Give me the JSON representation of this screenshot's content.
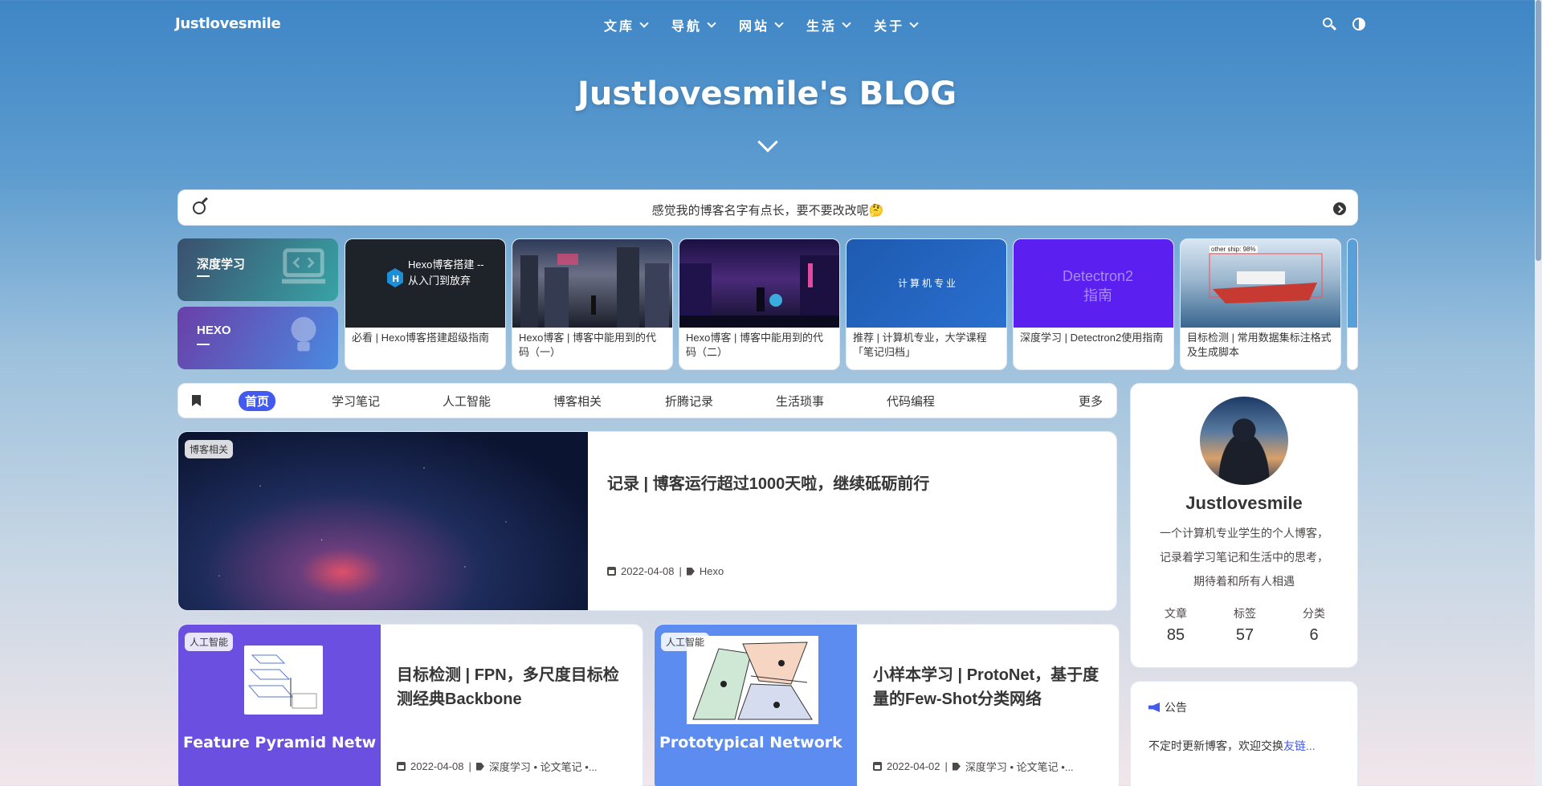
{
  "nav": {
    "brand": "Justlovesmile",
    "menu": [
      "文库",
      "导航",
      "网站",
      "生活",
      "关于"
    ],
    "icons": [
      "search-icon",
      "darkmode-icon"
    ]
  },
  "hero": {
    "title": "Justlovesmile's BLOG"
  },
  "announcement": {
    "text": "感觉我的博客名字有点长，要不要改改呢🤔"
  },
  "categories": [
    {
      "label": "深度学习"
    },
    {
      "label": "HEXO"
    }
  ],
  "swiper": [
    {
      "title": "必看 | Hexo博客搭建超级指南",
      "img_text": "Hexo博客搭建 -- 从入门到放弃"
    },
    {
      "title": "Hexo博客 | 博客中能用到的代码（一）"
    },
    {
      "title": "Hexo博客 | 博客中能用到的代码（二）"
    },
    {
      "title": "推荐 | 计算机专业，大学课程「笔记归档」",
      "img_text": "计算机专业"
    },
    {
      "title": "深度学习 | Detectron2使用指南",
      "img_text": "Detectron2 指南"
    },
    {
      "title": "目标检测 | 常用数据集标注格式及生成脚本",
      "img_text": "other ship: 98%"
    }
  ],
  "tabs": {
    "items": [
      "首页",
      "学习笔记",
      "人工智能",
      "博客相关",
      "折腾记录",
      "生活琐事",
      "代码编程"
    ],
    "more": "更多"
  },
  "posts": [
    {
      "tag": "博客相关",
      "title": "记录 | 博客运行超过1000天啦，继续砥砺前行",
      "date": "2022-04-08",
      "tags": "Hexo"
    },
    {
      "tag": "人工智能",
      "title": "目标检测 | FPN，多尺度目标检测经典Backbone",
      "date": "2022-04-08",
      "tags": "深度学习 • 论文笔记 •...",
      "img_caption": "Feature Pyramid Netw"
    },
    {
      "tag": "人工智能",
      "title": "小样本学习 | ProtoNet，基于度量的Few-Shot分类网络",
      "date": "2022-04-02",
      "tags": "深度学习 • 论文笔记 •...",
      "img_caption": "Prototypical Network"
    }
  ],
  "profile": {
    "name": "Justlovesmile",
    "bio": [
      "一个计算机专业学生的个人博客，",
      "记录着学习笔记和生活中的思考，",
      "期待着和所有人相遇"
    ],
    "stats": [
      {
        "label": "文章",
        "value": "85"
      },
      {
        "label": "标签",
        "value": "57"
      },
      {
        "label": "分类",
        "value": "6"
      }
    ]
  },
  "notice": {
    "title": "公告",
    "text": "不定时更新博客，欢迎交换",
    "link": "友链..."
  }
}
